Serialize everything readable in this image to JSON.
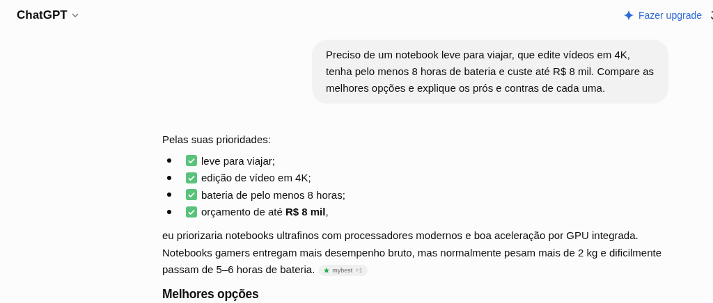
{
  "header": {
    "title": "ChatGPT",
    "upgrade_label": "Fazer upgrade"
  },
  "user_message": "Preciso de um notebook leve para viajar, que edite vídeos em 4K, tenha pelo menos 8 horas de bateria e custe até R$ 8 mil. Compare as melhores opções e explique os prós e contras de cada uma.",
  "answer": {
    "intro": "Pelas suas prioridades:",
    "items": [
      {
        "text": "leve para viajar;"
      },
      {
        "text": "edição de vídeo em 4K;"
      },
      {
        "text": "bateria de pelo menos 8 horas;"
      },
      {
        "text": "orçamento de até **R$ 8 mil**,"
      }
    ],
    "paragraph": "eu priorizaria notebooks ultrafinos com processadores modernos e boa aceleração por GPU integrada. Notebooks gamers entregam mais desempenho bruto, mas normalmente pesam mais de 2 kg e dificilmente passam de 5–6 horas de bateria.",
    "citation": {
      "source": "mybest",
      "extra": "+1"
    },
    "heading": "Melhores opções"
  }
}
